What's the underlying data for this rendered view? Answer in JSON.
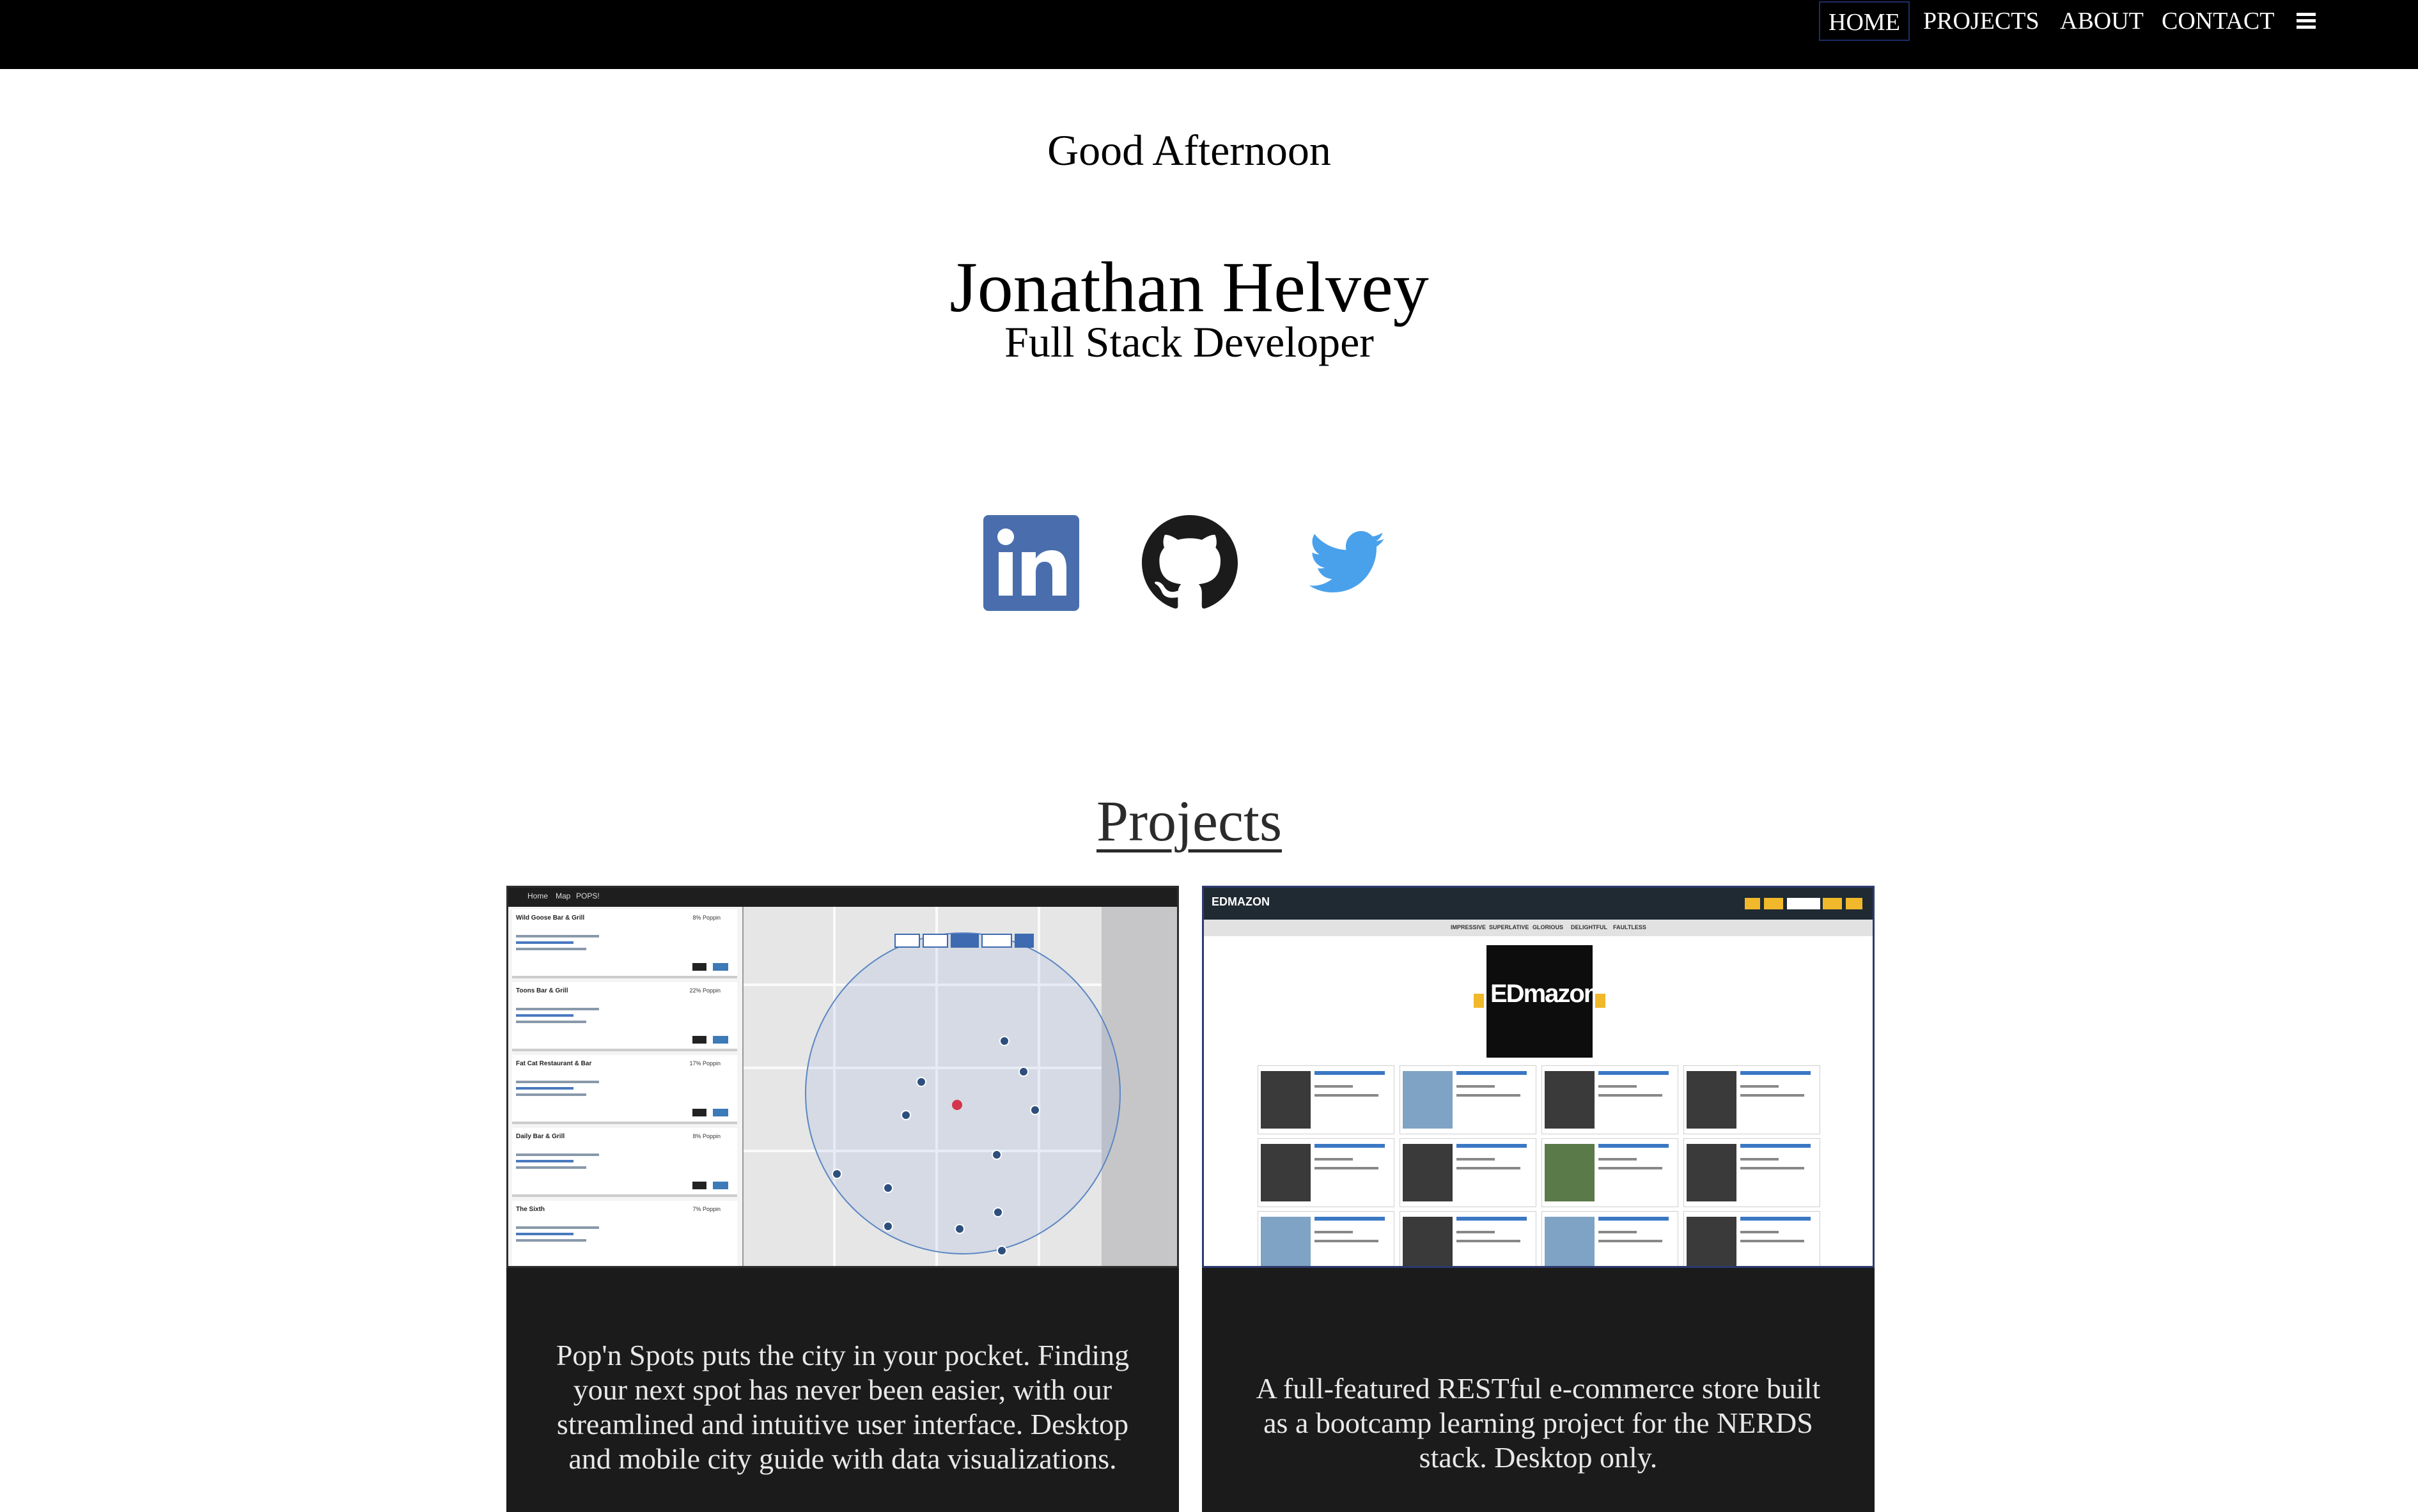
{
  "nav": {
    "items": [
      "HOME",
      "PROJECTS",
      "ABOUT",
      "CONTACT"
    ],
    "active": "HOME",
    "menu_icon": "hamburger-icon"
  },
  "hero": {
    "greeting": "Good Afternoon",
    "name": "Jonathan Helvey",
    "title": "Full Stack Developer"
  },
  "social": [
    {
      "name": "linkedin",
      "icon": "linkedin-icon",
      "color": "#4a6ead"
    },
    {
      "name": "github",
      "icon": "github-icon",
      "color": "#1b1b1b"
    },
    {
      "name": "twitter",
      "icon": "twitter-icon",
      "color": "#4aa1eb"
    }
  ],
  "projects": {
    "heading": "Projects",
    "items": [
      {
        "screenshot": {
          "nav_links": [
            "Home",
            "Map",
            "POPS!"
          ],
          "venues": [
            {
              "name": "Wild Goose Bar & Grill",
              "poppin": "8% Poppin"
            },
            {
              "name": "Toons Bar & Grill",
              "poppin": "22% Poppin"
            },
            {
              "name": "Fat Cat Restaurant & Bar",
              "poppin": "17% Poppin"
            },
            {
              "name": "Daily Bar & Grill",
              "poppin": "8% Poppin"
            },
            {
              "name": "The Sixth",
              "poppin": "7% Poppin"
            }
          ]
        },
        "description": "Pop'n Spots puts the city in your pocket. Finding your next spot has never been easier, with our streamlined and intuitive user interface. Desktop and mobile city guide with data visualizations."
      },
      {
        "screenshot": {
          "logo": "EDMAZON",
          "categories": [
            "IMPRESSIVE",
            "SUPERLATIVE",
            "GLORIOUS",
            "DELIGHTFUL",
            "FAULTLESS"
          ],
          "hero_text": "EDmazon"
        },
        "description": "A full-featured RESTful e-commerce store built as a bootcamp learning project for the NERDS stack. Desktop only."
      }
    ]
  },
  "colors": {
    "nav_bg": "#000000",
    "panel_bg": "#1b1b1b",
    "active_border": "#1e2c66"
  }
}
